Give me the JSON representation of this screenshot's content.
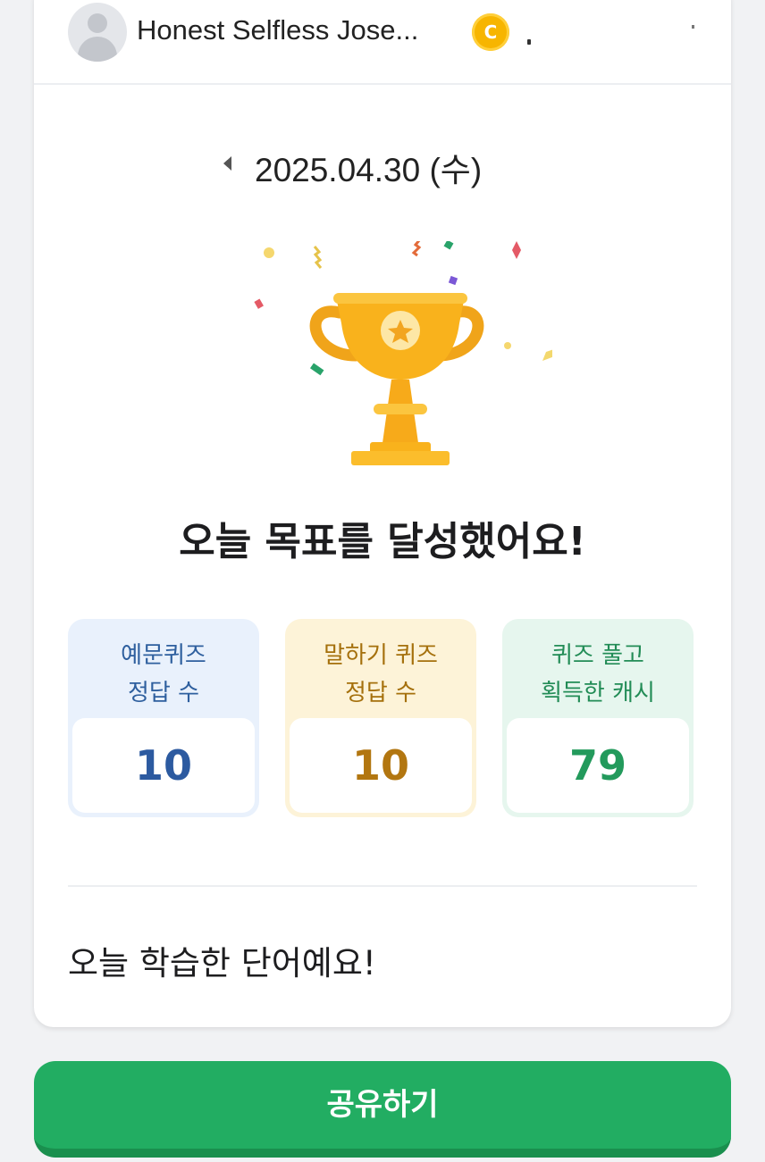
{
  "profile": {
    "username": "Honest Selfless Jose...",
    "coin_symbol": "C"
  },
  "date_nav": {
    "date": "2025.04.30 (수)"
  },
  "headline": "오늘 목표를 달성했어요!",
  "stats": [
    {
      "label_line1": "예문퀴즈",
      "label_line2": "정답 수",
      "value": "10"
    },
    {
      "label_line1": "말하기 퀴즈",
      "label_line2": "정답 수",
      "value": "10"
    },
    {
      "label_line1": "퀴즈 풀고",
      "label_line2": "획득한 캐시",
      "value": "79"
    }
  ],
  "words_section": {
    "title": "오늘 학습한 단어예요!"
  },
  "share_button": {
    "label": "공유하기"
  },
  "colors": {
    "accent_green": "#22ad62",
    "trophy_gold": "#f9b21c",
    "stat_blue": "#2c5aa0",
    "stat_gold": "#b27610",
    "stat_green": "#239a5c"
  }
}
